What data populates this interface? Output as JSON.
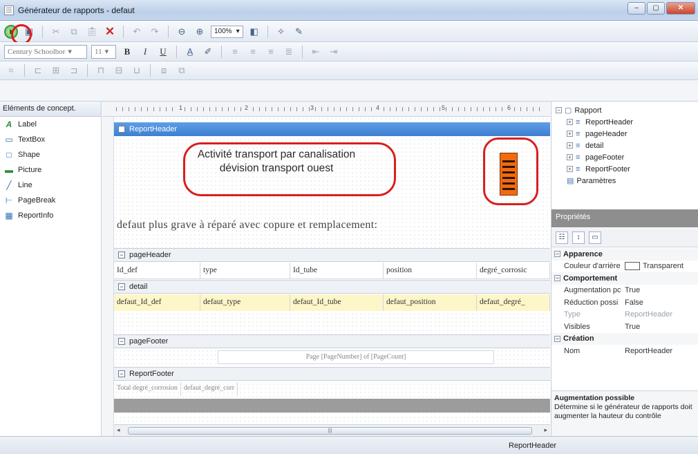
{
  "window": {
    "title": "Générateur de rapports - defaut",
    "minimize": "–",
    "maximize": "▢",
    "close": "✕"
  },
  "toolbar": {
    "zoom": "100%",
    "font_name": "Century Schoolbor",
    "font_size": "11",
    "bold": "B",
    "italic": "I",
    "underline": "U"
  },
  "left_panel": {
    "header": "Eléments de concept.",
    "tools": [
      {
        "label": "Label",
        "icon": "A"
      },
      {
        "label": "TextBox",
        "icon": "▭"
      },
      {
        "label": "Shape",
        "icon": "□"
      },
      {
        "label": "Picture",
        "icon": "▬"
      },
      {
        "label": "Line",
        "icon": "╱"
      },
      {
        "label": "PageBreak",
        "icon": "⊢"
      },
      {
        "label": "ReportInfo",
        "icon": "▦"
      }
    ]
  },
  "ruler": {
    "marks": [
      "1",
      "2",
      "3",
      "4",
      "5",
      "6"
    ]
  },
  "design": {
    "report_header_band": "ReportHeader",
    "title_line1": "Activité transport par canalisation",
    "title_line2": "dévision transport ouest",
    "subtitle": "defaut plus grave à réparé avec copure et remplacement:",
    "page_header_band": "pageHeader",
    "columns": [
      "Id_def",
      "type",
      "Id_tube",
      "position",
      "degré_corrosic"
    ],
    "detail_band": "detail",
    "detail_fields": [
      "defaut_Id_def",
      "defaut_type",
      "defaut_Id_tube",
      "defaut_position",
      "defaut_degré_"
    ],
    "page_footer_band": "pageFooter",
    "page_footer_text": "Page [PageNumber] of [PageCount]",
    "report_footer_band": "ReportFooter",
    "report_footer_fields": [
      "Total degré_corrosion",
      "defaut_degré_corr"
    ]
  },
  "tree": {
    "root": "Rapport",
    "children": [
      "ReportHeader",
      "pageHeader",
      "detail",
      "pageFooter",
      "ReportFooter"
    ],
    "params": "Paramètres"
  },
  "properties": {
    "header": "Propriétés",
    "categories": [
      {
        "name": "Apparence",
        "rows": [
          {
            "key": "Couleur d'arrière",
            "value": "Transparent",
            "dim": false
          }
        ]
      },
      {
        "name": "Comportement",
        "rows": [
          {
            "key": "Augmentation pc",
            "value": "True",
            "dim": false
          },
          {
            "key": "Réduction possi",
            "value": "False",
            "dim": false
          },
          {
            "key": "Type",
            "value": "ReportHeader",
            "dim": true
          },
          {
            "key": "Visibles",
            "value": "True",
            "dim": false
          }
        ]
      },
      {
        "name": "Création",
        "rows": [
          {
            "key": "Nom",
            "value": "ReportHeader",
            "dim": false
          }
        ]
      }
    ],
    "desc_title": "Augmentation possible",
    "desc_text": "Détermine si le générateur de rapports doit augmenter la hauteur du contrôle"
  },
  "status": {
    "text": "ReportHeader"
  },
  "colors": {
    "selected_band": "#3d7fd0",
    "annotation": "#d71f1f",
    "logo": "#f26a10",
    "detail_row": "#fdf6c8"
  }
}
